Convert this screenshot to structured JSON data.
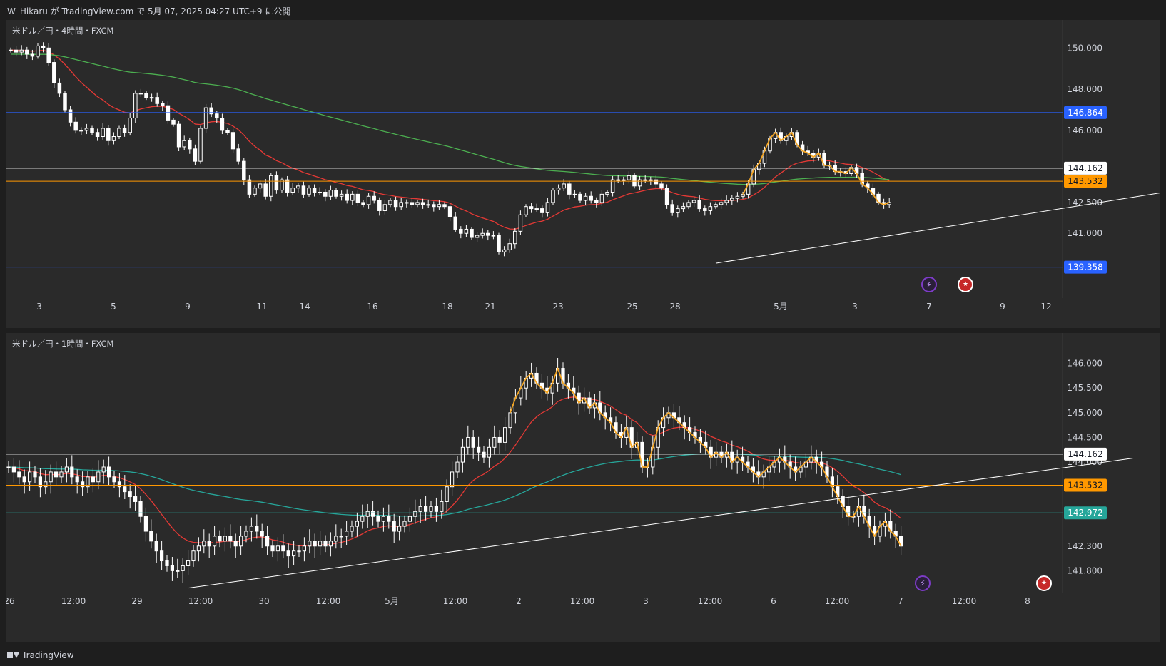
{
  "header": {
    "publish_text": "W_Hikaru が TradingView.com で 5月 07, 2025 04:27 UTC+9 に公開"
  },
  "footer": {
    "brand": "TradingView"
  },
  "colors": {
    "candle_up": "#ffffff",
    "candle_down": "#ffffff",
    "ma_red": "#e53935",
    "ma_green": "#4caf50",
    "ma_teal": "#26a69a",
    "zigzag": "#f5a623",
    "level_blue": "#2962ff",
    "level_orange": "#ff9800",
    "level_white": "#ffffff",
    "level_teal": "#26a69a",
    "trendline": "#ffffff"
  },
  "icons": {
    "event_bolt": "lightning-bolt-icon",
    "event_flag": "us-flag-icon"
  },
  "chart_data": [
    {
      "type": "candlestick",
      "title": "米ドル／円・4時間・FXCM",
      "ylim": [
        139.0,
        150.6
      ],
      "y_ticks": [
        "150.000",
        "148.000",
        "146.000",
        "142.500",
        "141.000"
      ],
      "y_tick_values": [
        150.0,
        148.0,
        146.0,
        142.5,
        141.0
      ],
      "x_ticks": [
        "3",
        "5",
        "9",
        "11",
        "14",
        "16",
        "18",
        "21",
        "23",
        "25",
        "28",
        "5月",
        "3",
        "7",
        "9",
        "12"
      ],
      "levels": [
        {
          "value": 146.864,
          "label": "146.864",
          "color": "#2962ff",
          "badge_bg": "#2962ff",
          "badge_fg": "#ffffff"
        },
        {
          "value": 144.162,
          "label": "144.162",
          "color": "#ffffff",
          "badge_bg": "#ffffff",
          "badge_fg": "#131722"
        },
        {
          "value": 143.532,
          "label": "143.532",
          "color": "#ff9800",
          "badge_bg": "#ff9800",
          "badge_fg": "#131722"
        },
        {
          "value": 139.358,
          "label": "139.358",
          "color": "#2962ff",
          "badge_bg": "#2962ff",
          "badge_fg": "#ffffff"
        }
      ],
      "trendline": {
        "from_bar": 130,
        "from_price": 139.55,
        "to_bar": 256,
        "to_price": 144.8
      },
      "closes": [
        149.9,
        149.8,
        149.9,
        149.7,
        149.6,
        150.1,
        150.0,
        149.3,
        148.3,
        147.8,
        147.0,
        146.4,
        146.0,
        146.0,
        146.1,
        145.9,
        145.7,
        146.1,
        145.5,
        145.7,
        146.1,
        145.9,
        146.6,
        147.8,
        147.8,
        147.6,
        147.6,
        147.3,
        147.2,
        146.5,
        146.3,
        145.2,
        145.5,
        145.1,
        144.5,
        146.1,
        147.1,
        146.8,
        146.6,
        146.0,
        145.9,
        145.1,
        144.5,
        143.6,
        142.9,
        143.2,
        143.4,
        142.8,
        143.8,
        143.1,
        143.6,
        143.0,
        143.2,
        143.3,
        142.9,
        143.2,
        143.0,
        143.0,
        142.8,
        143.1,
        142.8,
        142.9,
        142.6,
        142.9,
        142.5,
        142.4,
        142.8,
        142.6,
        142.1,
        142.4,
        142.6,
        142.3,
        142.5,
        142.5,
        142.4,
        142.5,
        142.4,
        142.4,
        142.3,
        142.4,
        142.3,
        141.8,
        141.2,
        141.0,
        141.2,
        140.8,
        140.9,
        141.0,
        140.9,
        140.9,
        140.1,
        140.2,
        140.5,
        141.1,
        141.9,
        142.3,
        142.2,
        142.2,
        142.0,
        142.5,
        143.1,
        143.2,
        143.4,
        142.9,
        142.9,
        142.6,
        142.8,
        142.6,
        142.5,
        142.9,
        143.0,
        143.6,
        143.6,
        143.6,
        143.8,
        143.3,
        143.6,
        143.6,
        143.6,
        143.4,
        143.2,
        142.4,
        142.0,
        142.2,
        142.3,
        142.5,
        142.6,
        142.2,
        142.1,
        142.3,
        142.4,
        142.5,
        142.6,
        142.7,
        142.8,
        142.9,
        143.4,
        144.1,
        144.4,
        145.0,
        145.6,
        145.9,
        145.5,
        145.7,
        145.9,
        145.3,
        145.0,
        144.9,
        144.7,
        144.9,
        144.3,
        144.3,
        144.0,
        144.0,
        143.9,
        144.2,
        143.9,
        143.4,
        143.2,
        142.9,
        142.5,
        142.4,
        142.5
      ]
    },
    {
      "type": "candlestick",
      "title": "米ドル／円・1時間・FXCM",
      "ylim": [
        141.3,
        146.5
      ],
      "y_ticks": [
        "146.000",
        "145.500",
        "145.000",
        "144.500",
        "144.000",
        "142.300",
        "141.800"
      ],
      "y_tick_values": [
        146.0,
        145.5,
        145.0,
        144.5,
        144.0,
        142.3,
        141.8
      ],
      "x_ticks": [
        "26",
        "12:00",
        "29",
        "12:00",
        "30",
        "12:00",
        "5月",
        "12:00",
        "2",
        "12:00",
        "3",
        "12:00",
        "6",
        "12:00",
        "7",
        "12:00",
        "8"
      ],
      "levels": [
        {
          "value": 144.162,
          "label": "144.162",
          "color": "#ffffff",
          "badge_bg": "#ffffff",
          "badge_fg": "#131722"
        },
        {
          "value": 143.532,
          "label": "143.532",
          "color": "#ff9800",
          "badge_bg": "#ff9800",
          "badge_fg": "#131722"
        },
        {
          "value": 142.972,
          "label": "142.972",
          "color": "#26a69a",
          "badge_bg": "#26a69a",
          "badge_fg": "#ffffff"
        }
      ],
      "trendline": {
        "from_bar": 34,
        "from_price": 141.45,
        "to_bar": 213,
        "to_price": 144.08
      },
      "closes": [
        143.9,
        143.8,
        143.7,
        143.6,
        143.8,
        143.7,
        143.5,
        143.6,
        143.8,
        143.7,
        143.8,
        143.9,
        143.7,
        143.6,
        143.5,
        143.7,
        143.6,
        143.8,
        143.9,
        143.7,
        143.6,
        143.5,
        143.4,
        143.3,
        143.2,
        142.9,
        142.6,
        142.4,
        142.2,
        142.0,
        141.9,
        141.8,
        141.8,
        141.9,
        142.0,
        142.2,
        142.3,
        142.4,
        142.3,
        142.5,
        142.4,
        142.5,
        142.4,
        142.3,
        142.5,
        142.6,
        142.7,
        142.6,
        142.5,
        142.3,
        142.2,
        142.3,
        142.2,
        142.1,
        142.2,
        142.2,
        142.3,
        142.4,
        142.3,
        142.4,
        142.3,
        142.4,
        142.5,
        142.5,
        142.6,
        142.7,
        142.8,
        142.9,
        143.0,
        142.9,
        142.8,
        142.9,
        142.8,
        142.6,
        142.7,
        142.8,
        142.9,
        143.0,
        143.1,
        143.0,
        143.1,
        143.0,
        143.2,
        143.5,
        143.8,
        144.0,
        144.3,
        144.5,
        144.3,
        144.2,
        144.1,
        144.3,
        144.5,
        144.4,
        144.7,
        145.0,
        145.3,
        145.5,
        145.7,
        145.8,
        145.6,
        145.5,
        145.4,
        145.6,
        145.9,
        145.6,
        145.5,
        145.4,
        145.2,
        145.3,
        145.1,
        145.2,
        145.0,
        144.9,
        144.8,
        144.6,
        144.5,
        144.7,
        144.3,
        144.4,
        143.9,
        143.9,
        144.3,
        144.7,
        144.9,
        145.0,
        144.9,
        144.8,
        144.7,
        144.6,
        144.5,
        144.4,
        144.3,
        144.1,
        144.2,
        144.1,
        144.2,
        144.0,
        144.1,
        144.0,
        143.9,
        143.8,
        143.7,
        143.8,
        143.9,
        144.0,
        144.1,
        144.0,
        143.9,
        143.8,
        143.9,
        144.0,
        144.1,
        144.0,
        143.9,
        143.7,
        143.5,
        143.3,
        143.1,
        142.9,
        142.9,
        143.1,
        142.9,
        142.7,
        142.5,
        142.7,
        142.8,
        142.6,
        142.5,
        142.3
      ]
    }
  ]
}
